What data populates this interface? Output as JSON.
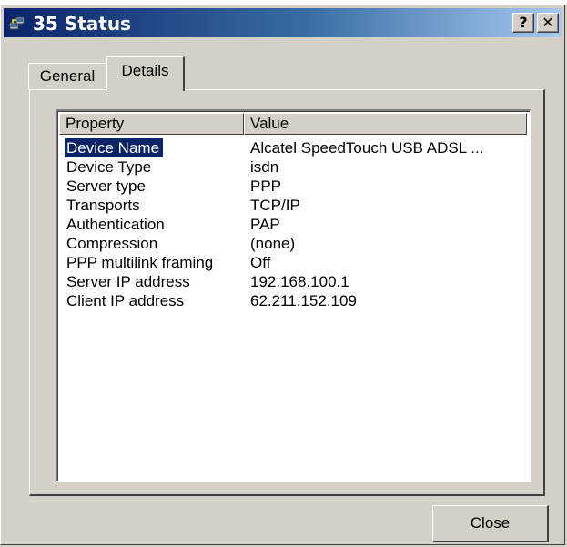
{
  "window": {
    "title": "35 Status",
    "help_label": "?",
    "close_label": "✕"
  },
  "tabs": [
    {
      "label": "General",
      "selected": false
    },
    {
      "label": "Details",
      "selected": true
    }
  ],
  "listview": {
    "columns": [
      "Property",
      "Value"
    ],
    "rows": [
      {
        "property": "Device Name",
        "value": "Alcatel SpeedTouch USB ADSL ...",
        "selected": true
      },
      {
        "property": "Device Type",
        "value": "isdn"
      },
      {
        "property": "Server type",
        "value": "PPP"
      },
      {
        "property": "Transports",
        "value": "TCP/IP"
      },
      {
        "property": "Authentication",
        "value": "PAP"
      },
      {
        "property": "Compression",
        "value": "(none)"
      },
      {
        "property": "PPP multilink framing",
        "value": "Off"
      },
      {
        "property": "Server IP address",
        "value": "192.168.100.1"
      },
      {
        "property": "Client IP address",
        "value": "62.211.152.109"
      }
    ]
  },
  "footer": {
    "close_button_label": "Close"
  },
  "colors": {
    "titlebar_start": "#0a246a",
    "titlebar_end": "#a6caf0",
    "selection": "#0a246a",
    "face": "#d4d0c8"
  }
}
